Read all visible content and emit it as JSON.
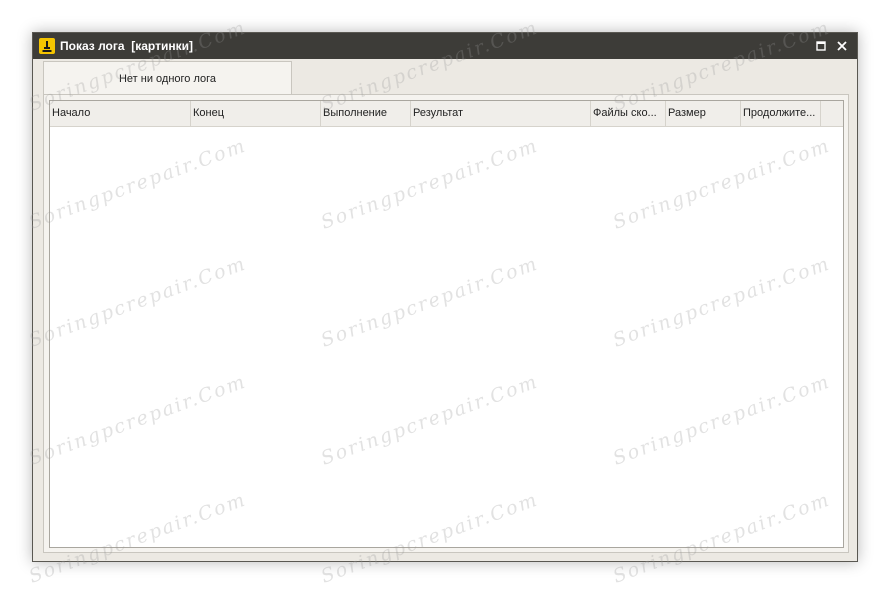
{
  "window": {
    "title": "Показ лога  [картинки]",
    "controls": {
      "maximize_icon": "maximize-icon",
      "close_icon": "close-icon"
    },
    "colors": {
      "titlebar": "#3d3c38",
      "app_icon": "#f4c400",
      "body": "#ece9e3"
    }
  },
  "tabs": [
    {
      "label": "Нет ни одного лога"
    }
  ],
  "table": {
    "columns": [
      "Начало",
      "Конец",
      "Выполнение",
      "Результат",
      "Файлы ско...",
      "Размер",
      "Продолжите..."
    ],
    "rows": []
  },
  "watermark": "Soringpcrepair.Com"
}
